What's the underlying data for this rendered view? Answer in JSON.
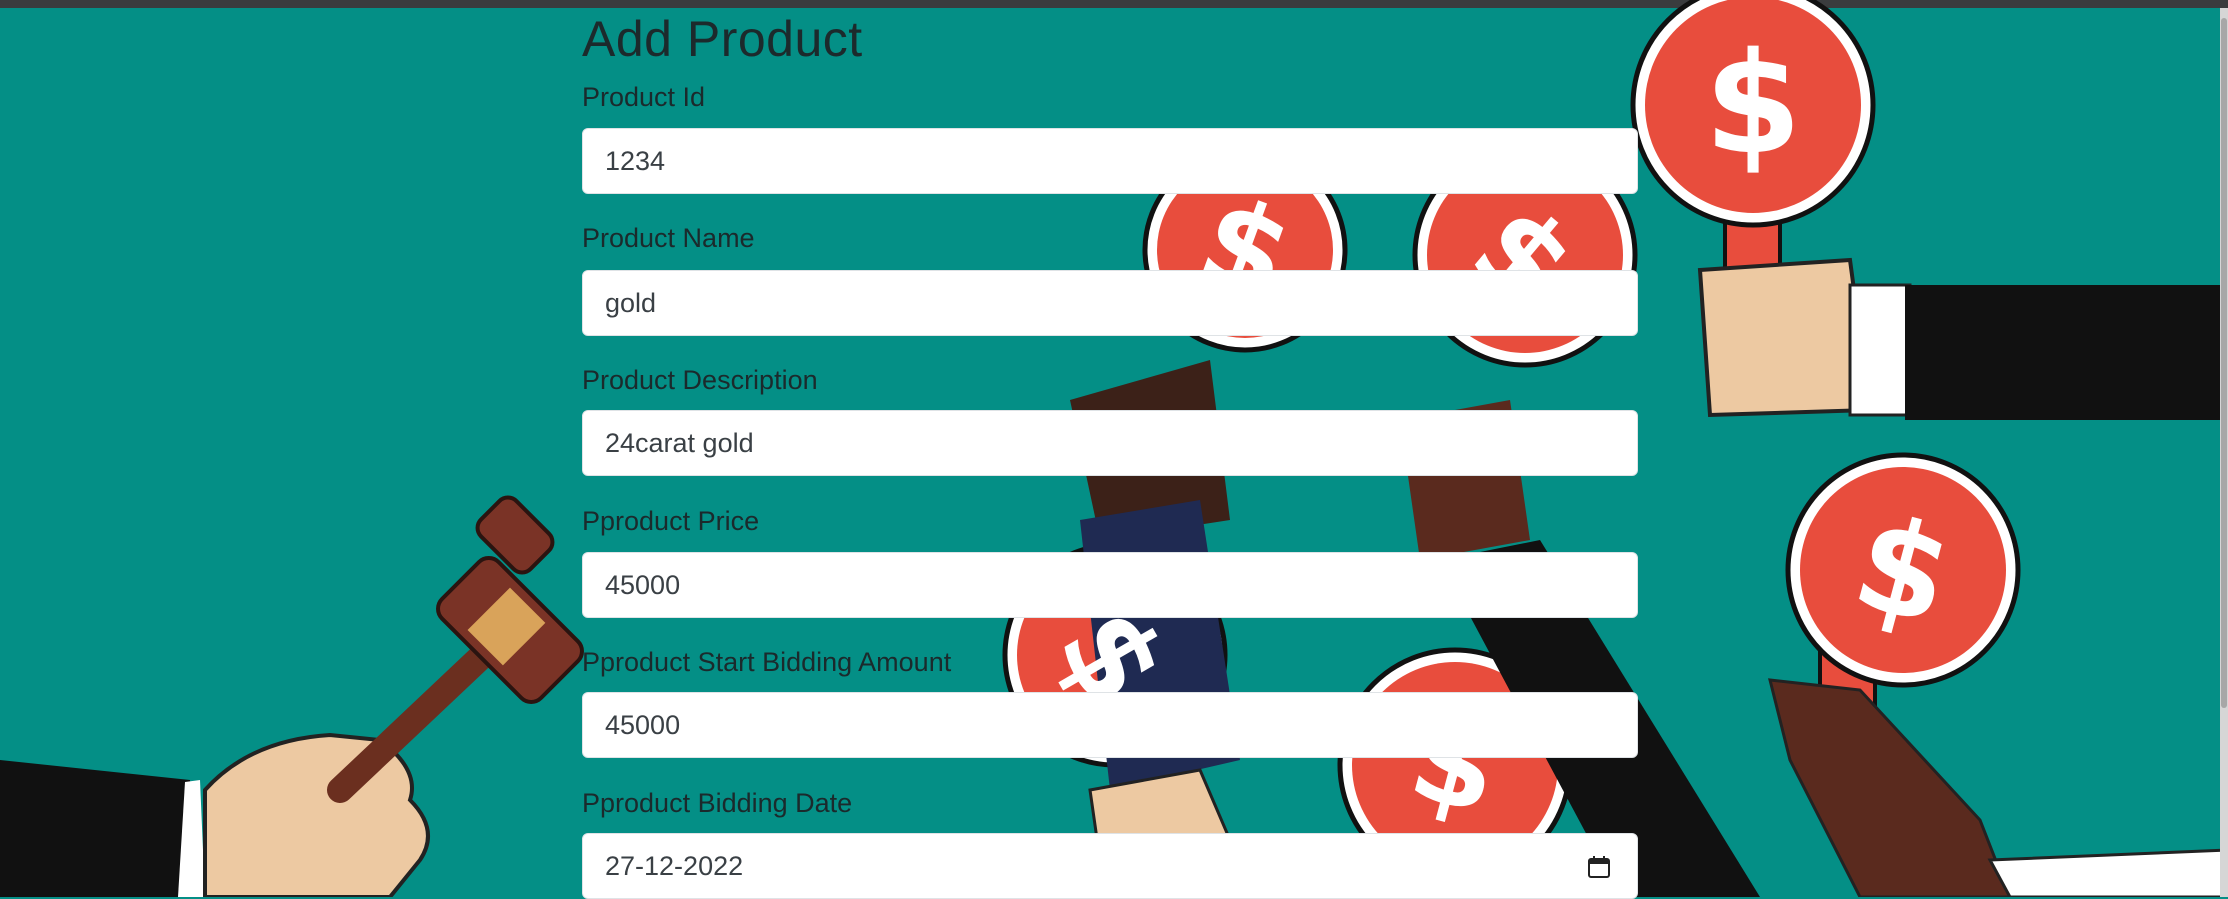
{
  "form": {
    "title": "Add Product",
    "fields": [
      {
        "label": "Product Id",
        "value": "1234"
      },
      {
        "label": "Product Name",
        "value": "gold"
      },
      {
        "label": "Product Description",
        "value": "24carat gold"
      },
      {
        "label": "Pproduct Price",
        "value": "45000"
      },
      {
        "label": "Pproduct Start Bidding Amount",
        "value": "45000"
      },
      {
        "label": "Pproduct Bidding Date",
        "value": "27-12-2022"
      }
    ]
  },
  "icons": {
    "date_picker": "calendar-icon",
    "background": "auction-paddles-and-gavel-illustration"
  },
  "colors": {
    "background": "#048f86",
    "paddle": "#e84d3d",
    "input_bg": "#ffffff",
    "text": "#1b2a2c"
  }
}
